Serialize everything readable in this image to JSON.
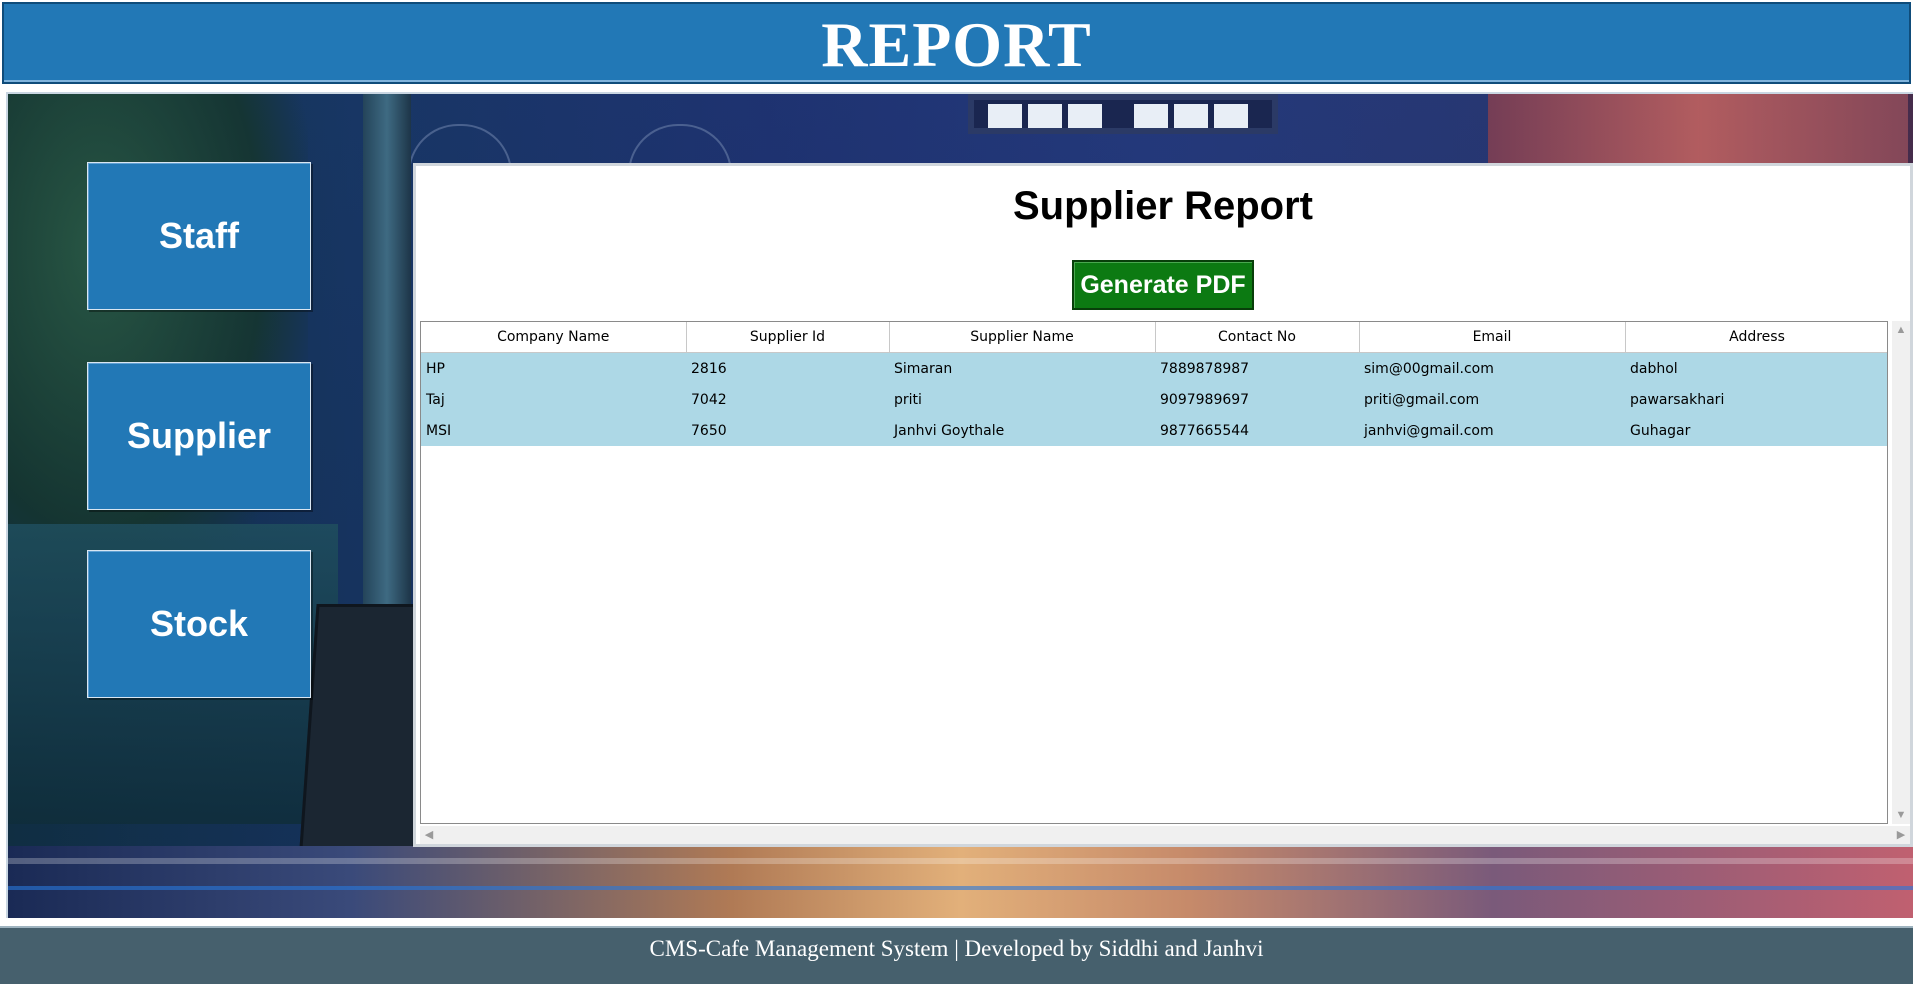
{
  "header": {
    "title": "REPORT"
  },
  "nav": {
    "staff_label": "Staff",
    "supplier_label": "Supplier",
    "stock_label": "Stock"
  },
  "report": {
    "title": "Supplier Report",
    "pdf_button_label": "Generate PDF",
    "columns": [
      "Company Name",
      "Supplier Id",
      "Supplier Name",
      "Contact No",
      "Email",
      "Address"
    ],
    "rows": [
      [
        "HP",
        "2816",
        "Simaran",
        "7889878987",
        "sim@00gmail.com",
        "dabhol"
      ],
      [
        "Taj",
        "7042",
        "priti",
        "9097989697",
        "priti@gmail.com",
        "pawarsakhari"
      ],
      [
        "MSI",
        "7650",
        "Janhvi Goythale",
        "9877665544",
        "janhvi@gmail.com",
        "Guhagar"
      ]
    ]
  },
  "scrollbar_icons": [
    "scroll-up-icon",
    "scroll-down-icon",
    "scroll-left-icon",
    "scroll-right-icon"
  ],
  "footer": {
    "text": "CMS-Cafe Management System | Developed by Siddhi and Janhvi"
  },
  "colors": {
    "header_bg": "#2278b6",
    "nav_button_bg": "#2278b6",
    "pdf_button_bg": "#0c7a12",
    "row_bg": "#add8e6",
    "footer_bg": "#46606d"
  }
}
